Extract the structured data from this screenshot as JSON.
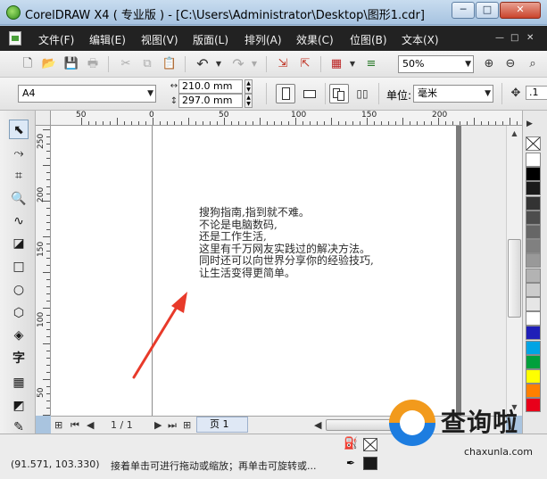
{
  "window": {
    "title": "CorelDRAW X4 ( 专业版 ) - [C:\\Users\\Administrator\\Desktop\\图形1.cdr]",
    "minimize": "─",
    "maximize": "□",
    "close": "✕"
  },
  "menu": {
    "items": [
      "文件(F)",
      "编辑(E)",
      "视图(V)",
      "版面(L)",
      "排列(A)",
      "效果(C)",
      "位图(B)",
      "文本(X)"
    ],
    "mdi_min": "—",
    "mdi_restore": "□",
    "mdi_close": "✕"
  },
  "toolbar": {
    "zoom_value": "50%"
  },
  "property_bar": {
    "paper_size": "A4",
    "width": "210.0 mm",
    "height": "297.0 mm",
    "units_label": "单位:",
    "units_value": "毫米",
    "nudge_value": ".1"
  },
  "rulers": {
    "horizontal_labels": [
      "50",
      "0",
      "50",
      "100",
      "150",
      "200"
    ],
    "vertical_labels": [
      "250",
      "200",
      "150",
      "100",
      "50"
    ]
  },
  "canvas": {
    "paragraph_lines": [
      "搜狗指南,指到就不难。",
      "不论是电脑数码,",
      "还是工作生活,",
      "这里有千万网友实践过的解决方法。",
      "同时还可以向世界分享你的经验技巧,",
      "让生活变得更简单。"
    ]
  },
  "navigation": {
    "page_counter": "1 / 1",
    "page_tab": "页 1"
  },
  "status": {
    "coordinates": "(91.571, 103.330)",
    "message": "接着单击可进行拖动或缩放；再单击可旋转或..."
  },
  "palette_colors": [
    "#ffffff",
    "#000000",
    "#1a1a1a",
    "#333333",
    "#4d4d4d",
    "#666666",
    "#808080",
    "#999999",
    "#b3b3b3",
    "#cccccc",
    "#e6e6e6",
    "#ffffff",
    "#1f1fb8",
    "#00a4e4",
    "#00a03c",
    "#ffff00",
    "#ff8000",
    "#e8001a"
  ],
  "watermark": {
    "brand": "查询啦",
    "domain": "chaxunla.com"
  }
}
